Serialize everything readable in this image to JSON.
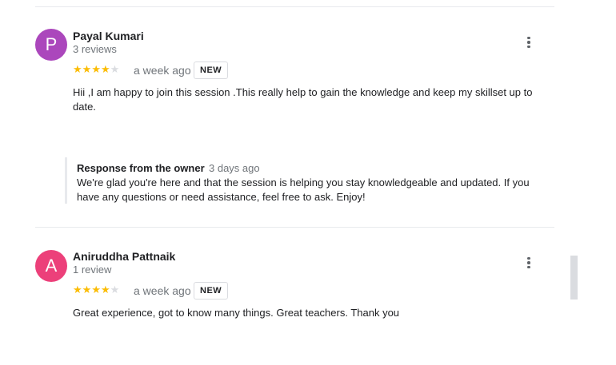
{
  "reviews": [
    {
      "avatar_letter": "P",
      "avatar_color": "#ab47bc",
      "name": "Payal Kumari",
      "review_count": "3 reviews",
      "rating": 4,
      "rating_max": 5,
      "time": "a week ago",
      "badge": "NEW",
      "text": "Hii ,I am happy to join this session .This really help to gain the knowledge and keep my skillset up to date.",
      "owner_response": {
        "title": "Response from the owner",
        "time": "3 days ago",
        "text": "We're glad you're here and that the session is helping you stay knowledgeable and updated. If you have any questions or need assistance, feel free to ask. Enjoy!"
      }
    },
    {
      "avatar_letter": "A",
      "avatar_color": "#ec407a",
      "name": "Aniruddha Pattnaik",
      "review_count": "1 review",
      "rating": 4,
      "rating_max": 5,
      "time": "a week ago",
      "badge": "NEW",
      "text": "Great experience, got to know many things. Great teachers. Thank you"
    }
  ],
  "icons": {
    "more": "more-vert-icon",
    "star": "star-icon"
  },
  "colors": {
    "star_filled": "#fbbc04",
    "star_empty": "#dadce0",
    "secondary_text": "#70757a"
  }
}
